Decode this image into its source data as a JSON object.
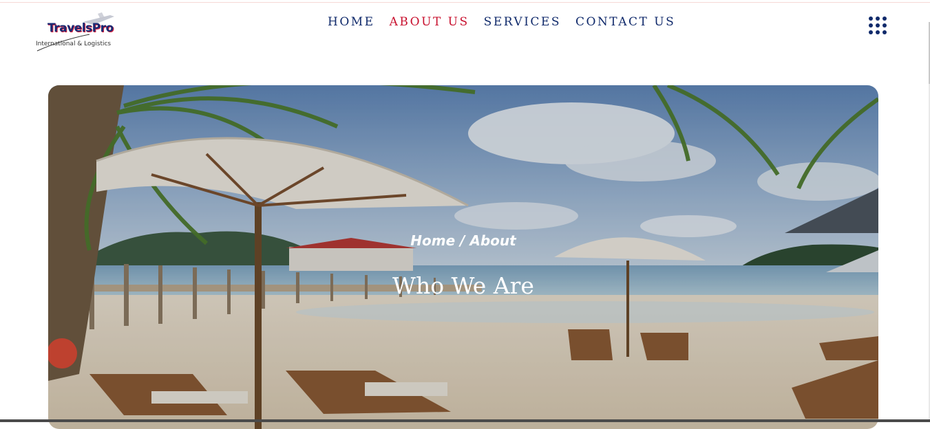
{
  "brand": {
    "name": "TravelsPro",
    "tagline": "International & Logistics"
  },
  "nav": {
    "items": [
      {
        "label": "HOME",
        "active": false
      },
      {
        "label": "ABOUT US",
        "active": true
      },
      {
        "label": "SERVICES",
        "active": false
      },
      {
        "label": "CONTACT US",
        "active": false
      }
    ]
  },
  "menu_icon": "grid-dots-icon",
  "hero": {
    "breadcrumb_home": "Home",
    "breadcrumb_separator": " / ",
    "breadcrumb_current": "About",
    "title": "Who We Are"
  },
  "colors": {
    "nav_text": "#102a6b",
    "nav_active": "#c8102e"
  }
}
